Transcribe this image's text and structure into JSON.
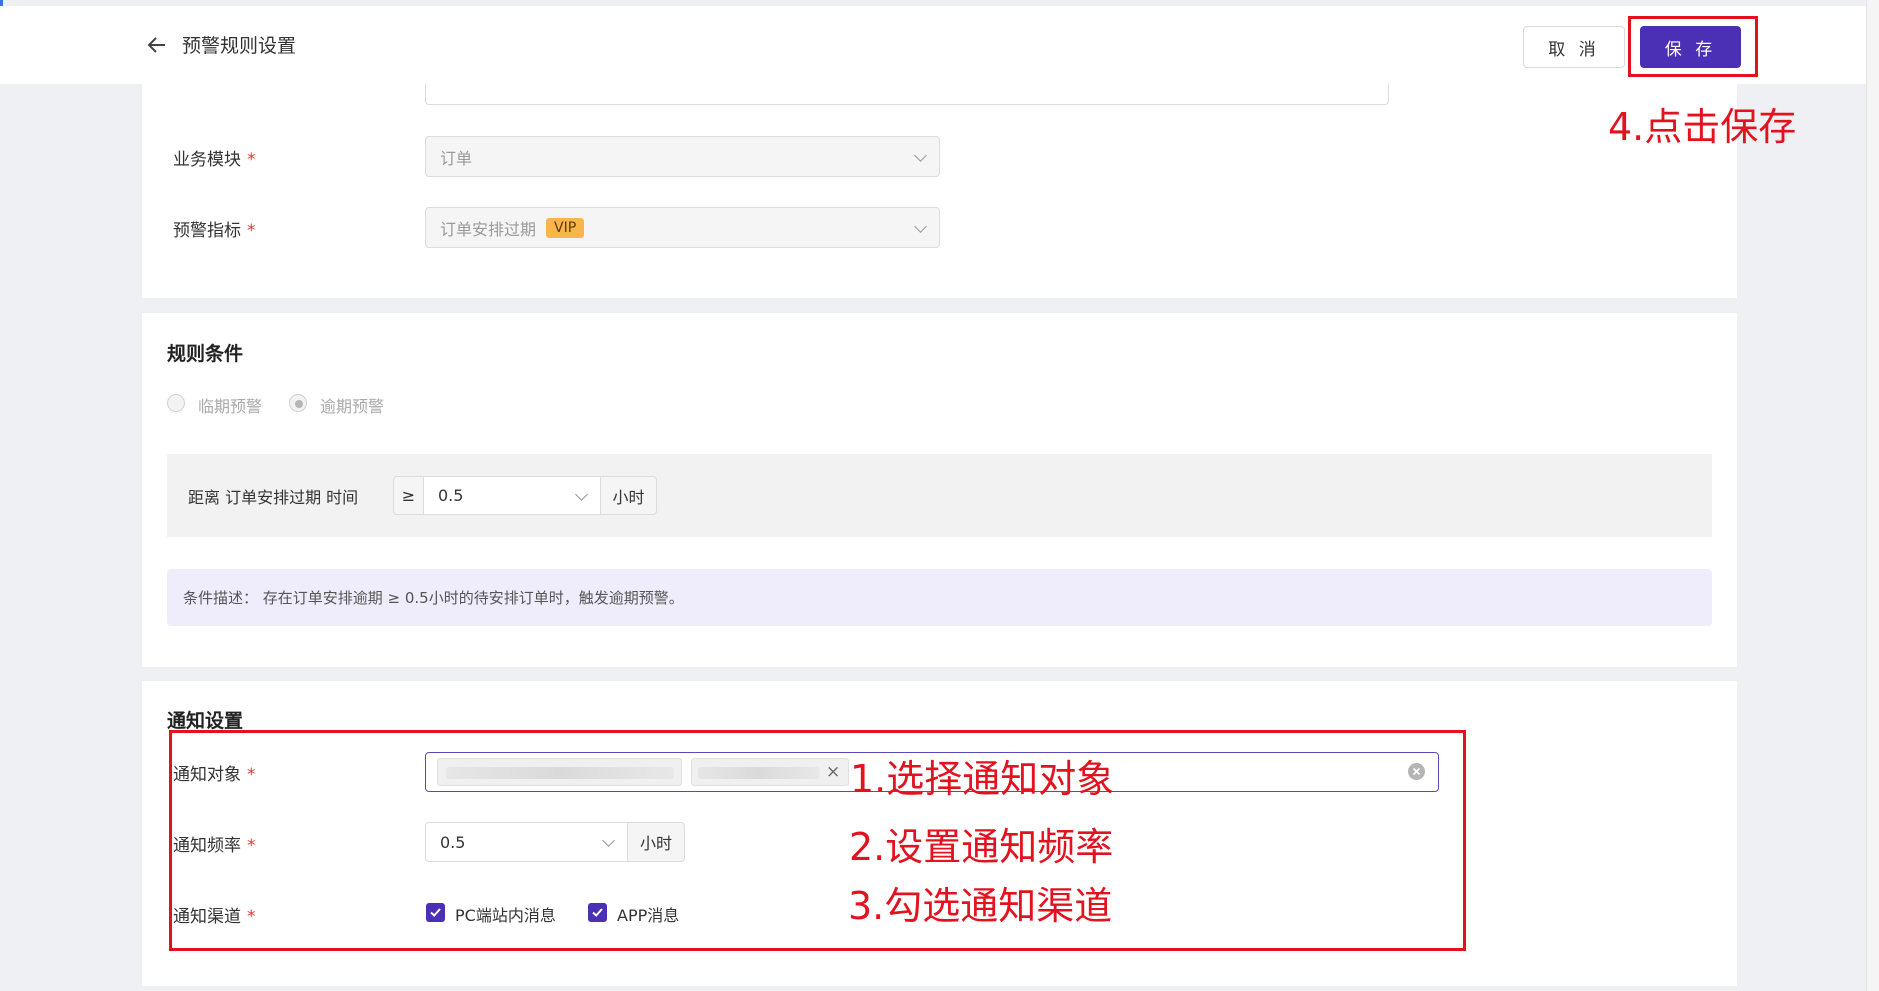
{
  "header": {
    "title": "预警规则设置",
    "cancel_label": "取 消",
    "save_label": "保 存"
  },
  "basic": {
    "module_label": "业务模块",
    "module_value": "订单",
    "indicator_label": "预警指标",
    "indicator_value": "订单安排过期",
    "indicator_badge": "VIP"
  },
  "rule": {
    "title": "规则条件",
    "radio_options": [
      "临期预警",
      "逾期预警"
    ],
    "selected_radio": "逾期预警",
    "distance_label": "距离 订单安排过期 时间",
    "operator": "≥",
    "threshold_value": "0.5",
    "unit": "小时",
    "description": "条件描述：  存在订单安排逾期 ≥ 0.5小时的待安排订单时，触发逾期预警。"
  },
  "notify": {
    "title": "通知设置",
    "target_label": "通知对象",
    "tag_remove_symbol": "×",
    "frequency_label": "通知频率",
    "frequency_value": "0.5",
    "frequency_unit": "小时",
    "channel_label": "通知渠道",
    "channels": [
      {
        "label": "PC端站内消息",
        "checked": true
      },
      {
        "label": "APP消息",
        "checked": true
      }
    ]
  },
  "required_mark": "*",
  "annotations": {
    "step1": "1.选择通知对象",
    "step2": "2.设置通知频率",
    "step3": "3.勾选通知渠道",
    "step4": "4.点击保存"
  },
  "colors": {
    "primary": "#4b2fb5",
    "annotation_red": "#e3121f",
    "required_red": "#e53935",
    "vip_badge": "#f8b54a"
  },
  "icons": {
    "back": "arrow-left-icon",
    "dropdown": "chevron-down-icon",
    "clear": "clear-circle-icon",
    "checkbox": "checkmark-icon"
  }
}
